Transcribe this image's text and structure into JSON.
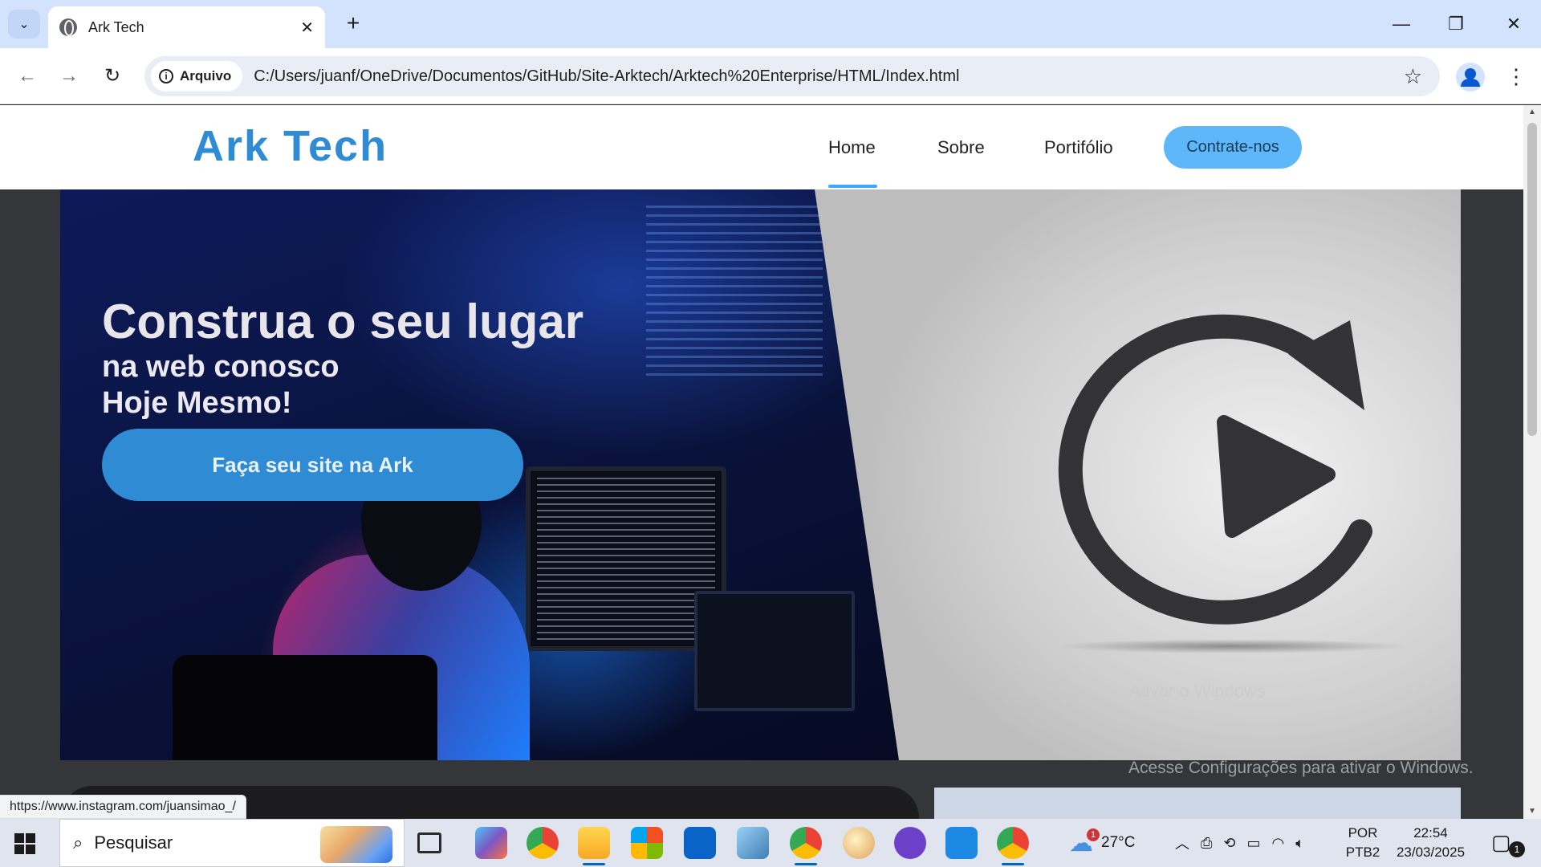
{
  "browser": {
    "tab_title": "Ark Tech",
    "close_tab": "✕",
    "new_tab": "+",
    "window_controls": {
      "minimize": "—",
      "restore": "❐",
      "close": "✕"
    },
    "back": "←",
    "forward": "→",
    "reload": "↻",
    "security_chip": "Arquivo",
    "url": "C:/Users/juanf/OneDrive/Documentos/GitHub/Site-Arktech/Arktech%20Enterprise/HTML/Index.html",
    "bookmark": "☆",
    "menu": "⋮",
    "status_url": "https://www.instagram.com/juansimao_/"
  },
  "site": {
    "logo": "Ark Tech",
    "nav": {
      "home": "Home",
      "sobre": "Sobre",
      "portfolio": "Portifólio",
      "cta": "Contrate-nos"
    },
    "hero": {
      "title": "Construa o seu lugar",
      "subtitle_line1": "na web conosco",
      "subtitle_line2": "Hoje Mesmo!",
      "button": "Faça seu site na Ark"
    },
    "accent_color": "#2f8bd3",
    "cta_color": "#5db7f8"
  },
  "watermark": {
    "faint_line": "Ativar o Windows",
    "activation": "Acesse Configurações para ativar o Windows."
  },
  "taskbar": {
    "search_placeholder": "Pesquisar",
    "weather": "27°C",
    "weather_badge": "1",
    "language": "POR",
    "layout": "PTB2",
    "time": "22:54",
    "date": "23/03/2025",
    "notification_count": "1",
    "apps": [
      "task-view",
      "copilot",
      "chrome",
      "file-explorer",
      "microsoft-store",
      "outlook",
      "notepad",
      "chrome-profile",
      "paint",
      "github-desktop",
      "vscode",
      "chrome-active"
    ]
  }
}
